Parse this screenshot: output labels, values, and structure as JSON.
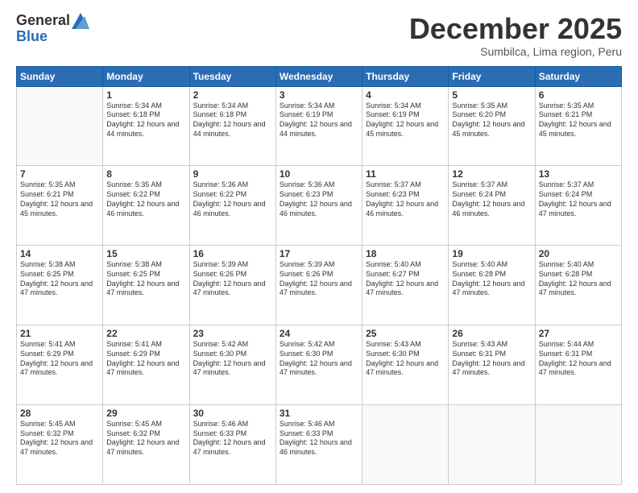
{
  "header": {
    "logo": {
      "general": "General",
      "blue": "Blue"
    },
    "title": "December 2025",
    "subtitle": "Sumbilca, Lima region, Peru"
  },
  "days_of_week": [
    "Sunday",
    "Monday",
    "Tuesday",
    "Wednesday",
    "Thursday",
    "Friday",
    "Saturday"
  ],
  "weeks": [
    [
      {
        "day": "",
        "sunrise": "",
        "sunset": "",
        "daylight": ""
      },
      {
        "day": "1",
        "sunrise": "Sunrise: 5:34 AM",
        "sunset": "Sunset: 6:18 PM",
        "daylight": "Daylight: 12 hours and 44 minutes."
      },
      {
        "day": "2",
        "sunrise": "Sunrise: 5:34 AM",
        "sunset": "Sunset: 6:18 PM",
        "daylight": "Daylight: 12 hours and 44 minutes."
      },
      {
        "day": "3",
        "sunrise": "Sunrise: 5:34 AM",
        "sunset": "Sunset: 6:19 PM",
        "daylight": "Daylight: 12 hours and 44 minutes."
      },
      {
        "day": "4",
        "sunrise": "Sunrise: 5:34 AM",
        "sunset": "Sunset: 6:19 PM",
        "daylight": "Daylight: 12 hours and 45 minutes."
      },
      {
        "day": "5",
        "sunrise": "Sunrise: 5:35 AM",
        "sunset": "Sunset: 6:20 PM",
        "daylight": "Daylight: 12 hours and 45 minutes."
      },
      {
        "day": "6",
        "sunrise": "Sunrise: 5:35 AM",
        "sunset": "Sunset: 6:21 PM",
        "daylight": "Daylight: 12 hours and 45 minutes."
      }
    ],
    [
      {
        "day": "7",
        "sunrise": "Sunrise: 5:35 AM",
        "sunset": "Sunset: 6:21 PM",
        "daylight": "Daylight: 12 hours and 45 minutes."
      },
      {
        "day": "8",
        "sunrise": "Sunrise: 5:35 AM",
        "sunset": "Sunset: 6:22 PM",
        "daylight": "Daylight: 12 hours and 46 minutes."
      },
      {
        "day": "9",
        "sunrise": "Sunrise: 5:36 AM",
        "sunset": "Sunset: 6:22 PM",
        "daylight": "Daylight: 12 hours and 46 minutes."
      },
      {
        "day": "10",
        "sunrise": "Sunrise: 5:36 AM",
        "sunset": "Sunset: 6:23 PM",
        "daylight": "Daylight: 12 hours and 46 minutes."
      },
      {
        "day": "11",
        "sunrise": "Sunrise: 5:37 AM",
        "sunset": "Sunset: 6:23 PM",
        "daylight": "Daylight: 12 hours and 46 minutes."
      },
      {
        "day": "12",
        "sunrise": "Sunrise: 5:37 AM",
        "sunset": "Sunset: 6:24 PM",
        "daylight": "Daylight: 12 hours and 46 minutes."
      },
      {
        "day": "13",
        "sunrise": "Sunrise: 5:37 AM",
        "sunset": "Sunset: 6:24 PM",
        "daylight": "Daylight: 12 hours and 47 minutes."
      }
    ],
    [
      {
        "day": "14",
        "sunrise": "Sunrise: 5:38 AM",
        "sunset": "Sunset: 6:25 PM",
        "daylight": "Daylight: 12 hours and 47 minutes."
      },
      {
        "day": "15",
        "sunrise": "Sunrise: 5:38 AM",
        "sunset": "Sunset: 6:25 PM",
        "daylight": "Daylight: 12 hours and 47 minutes."
      },
      {
        "day": "16",
        "sunrise": "Sunrise: 5:39 AM",
        "sunset": "Sunset: 6:26 PM",
        "daylight": "Daylight: 12 hours and 47 minutes."
      },
      {
        "day": "17",
        "sunrise": "Sunrise: 5:39 AM",
        "sunset": "Sunset: 6:26 PM",
        "daylight": "Daylight: 12 hours and 47 minutes."
      },
      {
        "day": "18",
        "sunrise": "Sunrise: 5:40 AM",
        "sunset": "Sunset: 6:27 PM",
        "daylight": "Daylight: 12 hours and 47 minutes."
      },
      {
        "day": "19",
        "sunrise": "Sunrise: 5:40 AM",
        "sunset": "Sunset: 6:28 PM",
        "daylight": "Daylight: 12 hours and 47 minutes."
      },
      {
        "day": "20",
        "sunrise": "Sunrise: 5:40 AM",
        "sunset": "Sunset: 6:28 PM",
        "daylight": "Daylight: 12 hours and 47 minutes."
      }
    ],
    [
      {
        "day": "21",
        "sunrise": "Sunrise: 5:41 AM",
        "sunset": "Sunset: 6:29 PM",
        "daylight": "Daylight: 12 hours and 47 minutes."
      },
      {
        "day": "22",
        "sunrise": "Sunrise: 5:41 AM",
        "sunset": "Sunset: 6:29 PM",
        "daylight": "Daylight: 12 hours and 47 minutes."
      },
      {
        "day": "23",
        "sunrise": "Sunrise: 5:42 AM",
        "sunset": "Sunset: 6:30 PM",
        "daylight": "Daylight: 12 hours and 47 minutes."
      },
      {
        "day": "24",
        "sunrise": "Sunrise: 5:42 AM",
        "sunset": "Sunset: 6:30 PM",
        "daylight": "Daylight: 12 hours and 47 minutes."
      },
      {
        "day": "25",
        "sunrise": "Sunrise: 5:43 AM",
        "sunset": "Sunset: 6:30 PM",
        "daylight": "Daylight: 12 hours and 47 minutes."
      },
      {
        "day": "26",
        "sunrise": "Sunrise: 5:43 AM",
        "sunset": "Sunset: 6:31 PM",
        "daylight": "Daylight: 12 hours and 47 minutes."
      },
      {
        "day": "27",
        "sunrise": "Sunrise: 5:44 AM",
        "sunset": "Sunset: 6:31 PM",
        "daylight": "Daylight: 12 hours and 47 minutes."
      }
    ],
    [
      {
        "day": "28",
        "sunrise": "Sunrise: 5:45 AM",
        "sunset": "Sunset: 6:32 PM",
        "daylight": "Daylight: 12 hours and 47 minutes."
      },
      {
        "day": "29",
        "sunrise": "Sunrise: 5:45 AM",
        "sunset": "Sunset: 6:32 PM",
        "daylight": "Daylight: 12 hours and 47 minutes."
      },
      {
        "day": "30",
        "sunrise": "Sunrise: 5:46 AM",
        "sunset": "Sunset: 6:33 PM",
        "daylight": "Daylight: 12 hours and 47 minutes."
      },
      {
        "day": "31",
        "sunrise": "Sunrise: 5:46 AM",
        "sunset": "Sunset: 6:33 PM",
        "daylight": "Daylight: 12 hours and 46 minutes."
      },
      {
        "day": "",
        "sunrise": "",
        "sunset": "",
        "daylight": ""
      },
      {
        "day": "",
        "sunrise": "",
        "sunset": "",
        "daylight": ""
      },
      {
        "day": "",
        "sunrise": "",
        "sunset": "",
        "daylight": ""
      }
    ]
  ]
}
